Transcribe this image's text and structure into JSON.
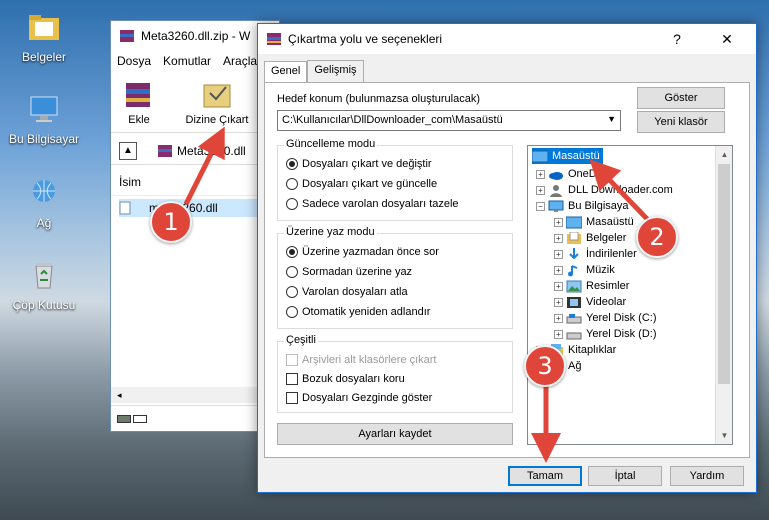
{
  "desktop": {
    "icons": [
      {
        "label": "Belgeler",
        "icon": "folder-icon"
      },
      {
        "label": "Bu Bilgisayar",
        "icon": "computer-icon"
      },
      {
        "label": "Ağ",
        "icon": "network-icon"
      },
      {
        "label": "Çöp Kutusu",
        "icon": "recycle-bin-icon"
      }
    ]
  },
  "winrar": {
    "title": "Meta3260.dll.zip - W",
    "menu": [
      "Dosya",
      "Komutlar",
      "Araçla"
    ],
    "toolbar": {
      "add": "Ekle",
      "extract_to": "Dizine Çıkart"
    },
    "path": "Meta3260.dll",
    "column_name": "İsim",
    "file": "meta3260.dll"
  },
  "dialog": {
    "title": "Çıkartma yolu ve seçenekleri",
    "help": "?",
    "close": "✕",
    "tabs": [
      "Genel",
      "Gelişmiş"
    ],
    "dest_label": "Hedef konum (bulunmazsa oluşturulacak)",
    "dest_value": "C:\\Kullanıcılar\\DllDownloader_com\\Masaüstü",
    "show_btn": "Göster",
    "new_folder_btn": "Yeni klasör",
    "update_mode": {
      "title": "Güncelleme modu",
      "options": [
        "Dosyaları çıkart ve değiştir",
        "Dosyaları çıkart ve güncelle",
        "Sadece varolan dosyaları tazele"
      ]
    },
    "overwrite_mode": {
      "title": "Üzerine yaz modu",
      "options": [
        "Üzerine yazmadan önce sor",
        "Sormadan üzerine yaz",
        "Varolan dosyaları atla",
        "Otomatik yeniden adlandır"
      ]
    },
    "misc": {
      "title": "Çeşitli",
      "options": [
        "Arşivleri alt klasörlere çıkart",
        "Bozuk dosyaları koru",
        "Dosyaları Gezginde göster"
      ]
    },
    "save_settings": "Ayarları kaydet",
    "tree": [
      "Masaüstü",
      "OneDr",
      "DLL Downloader.com",
      "Bu Bilgisaya",
      "Masaüstü",
      "Belgeler",
      "İndirilenler",
      "Müzik",
      "Resimler",
      "Videolar",
      "Yerel Disk (C:)",
      "Yerel Disk (D:)",
      "Kitaplıklar",
      "Ağ"
    ],
    "ok": "Tamam",
    "cancel": "İptal",
    "help_btn": "Yardım"
  },
  "callouts": [
    "1",
    "2",
    "3"
  ],
  "colors": {
    "accent": "#0078d7",
    "callout": "#e0453a",
    "arrow": "#e0453a"
  }
}
